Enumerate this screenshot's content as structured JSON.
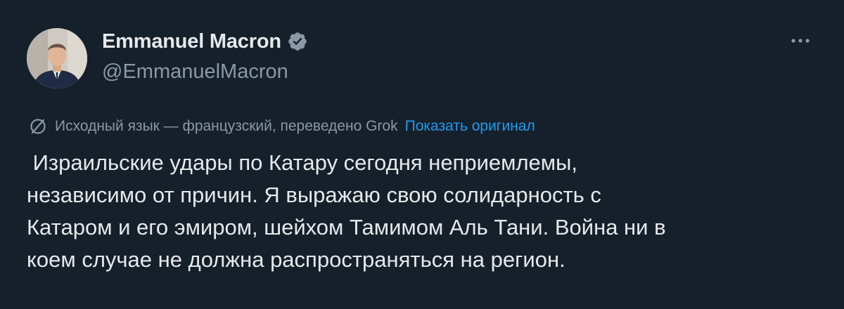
{
  "author": {
    "display_name": "Emmanuel Macron",
    "handle": "@EmmanuelMacron",
    "verified": true
  },
  "icons": {
    "verified": "verified-badge-icon",
    "more": "more-options-icon",
    "translate": "globe-translate-icon"
  },
  "translation": {
    "note": "Исходный язык — французский, переведено Grok",
    "show_original_label": "Показать оригинал"
  },
  "tweet": {
    "text": " Израильские удары по Катару сегодня неприемлемы,\nнезависимо от причин. Я выражаю свою солидарность с\nКатаром и его эмиром, шейхом Тамимом Аль Тани. Война ни в\nкоем случае не должна распространяться на регион."
  },
  "colors": {
    "background": "#15202b",
    "primary_text": "#e7e9ea",
    "secondary_text": "#8b98a5",
    "link": "#1d9bf0"
  }
}
